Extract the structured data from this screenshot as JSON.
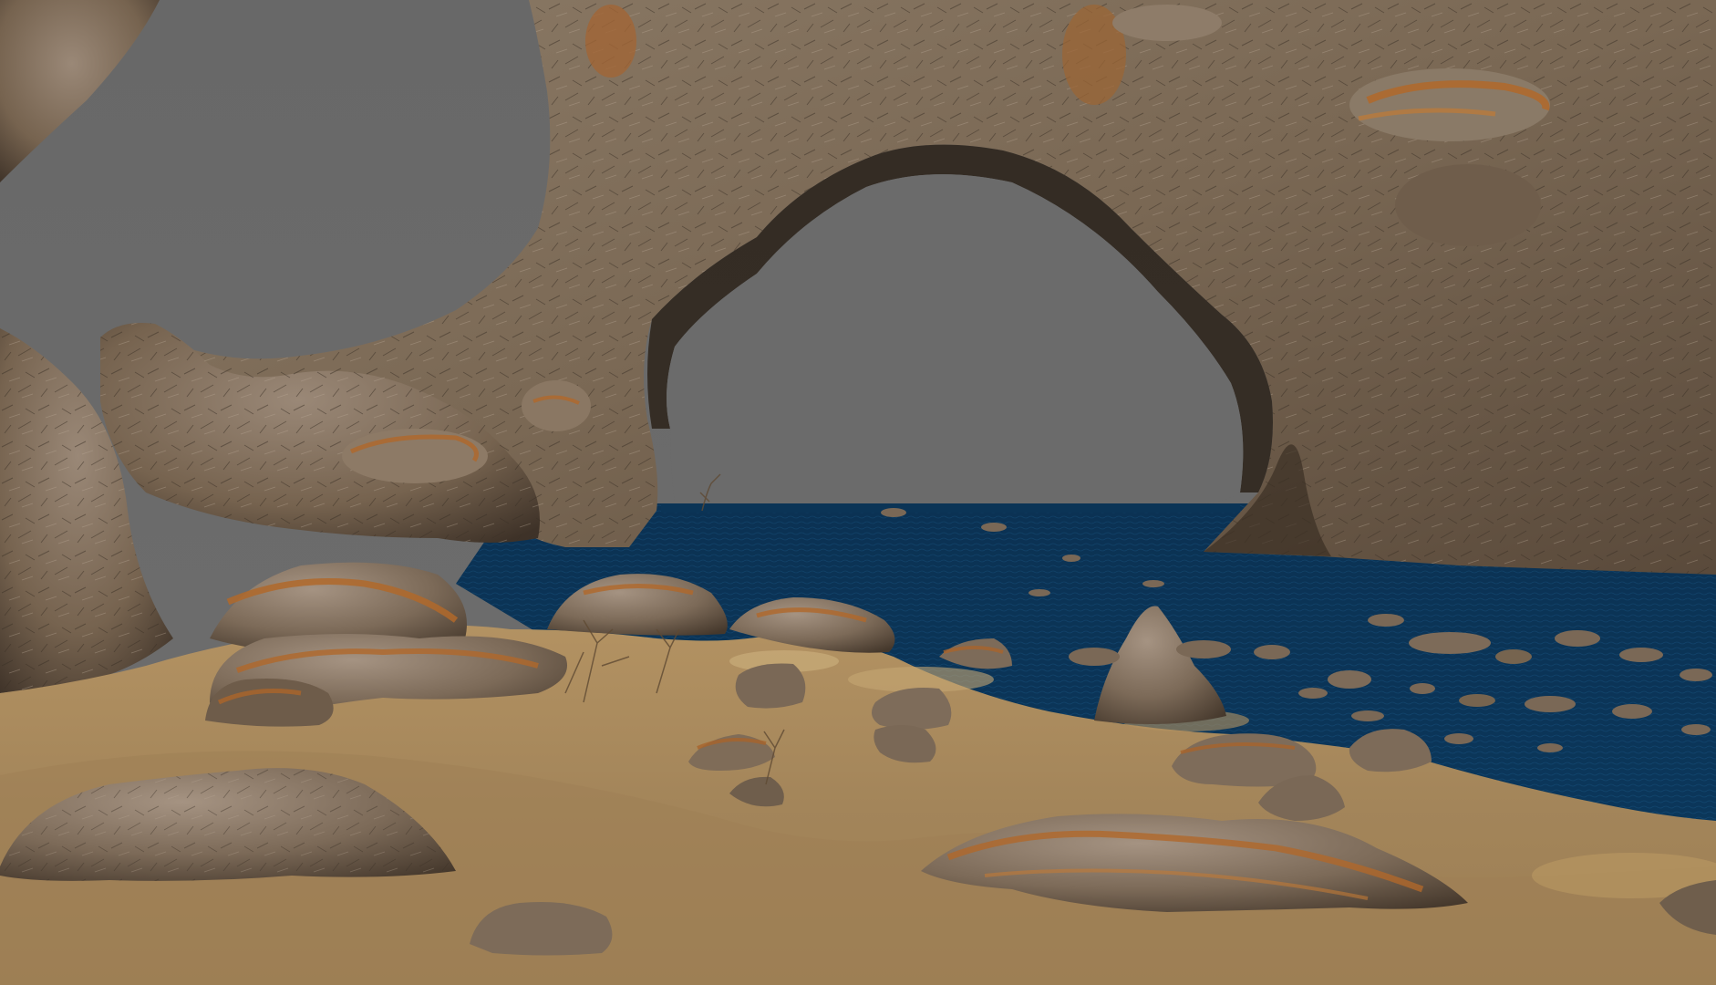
{
  "scene": {
    "sky_color": "#6b6b6b",
    "rock_color": "#7a6a58",
    "rock_dark": "#3c3128",
    "rock_light": "#a8998a",
    "lichen_color": "#b0682a",
    "sea_color": "#0b3456",
    "sea_highlight": "#1a5a86",
    "sand_color": "#a98a5c",
    "sand_dark": "#7d6443",
    "sand_light": "#c2a473"
  }
}
